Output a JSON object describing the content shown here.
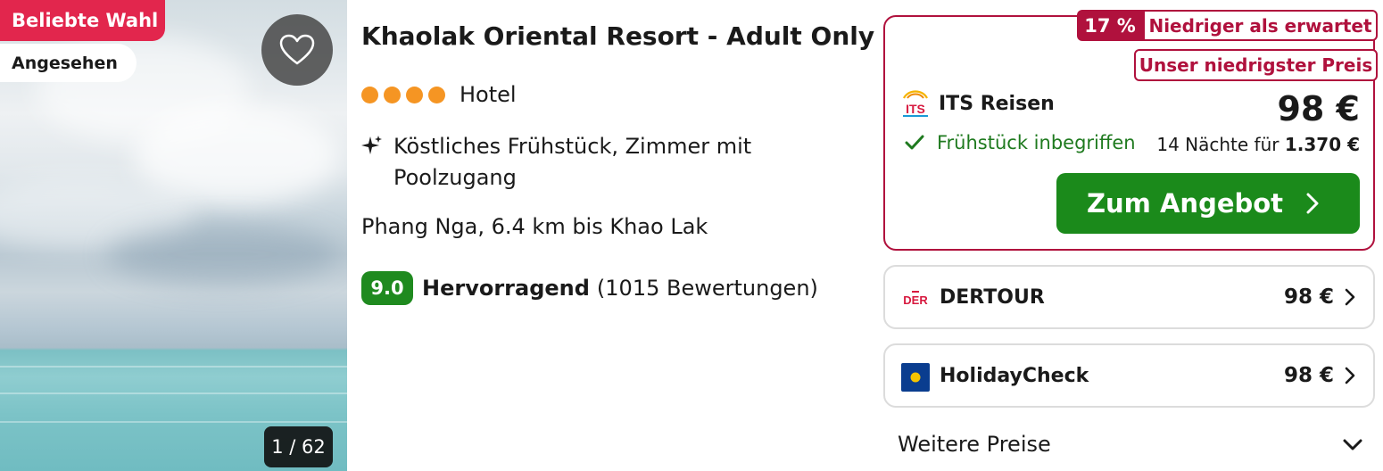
{
  "image": {
    "badge_popular": "Beliebte Wahl",
    "badge_seen": "Angesehen",
    "counter": "1 / 62"
  },
  "hotel": {
    "name": "Khaolak Oriental Resort - Adult Only",
    "stars": 4,
    "type": "Hotel",
    "feature": "Köstliches Frühstück, Zimmer mit Poolzugang",
    "location": "Phang Nga, 6.4 km bis Khao Lak",
    "rating_score": "9.0",
    "rating_word": "Hervorragend",
    "rating_count": "(1015 Bewertungen)"
  },
  "main_offer": {
    "discount_percent": "17 %",
    "discount_label": "Niedriger als erwartet",
    "lowest_label": "Unser niedrigster Preis",
    "provider_logo": "ITS",
    "provider": "ITS Reisen",
    "price": "98 €",
    "breakfast": "Frühstück inbegriffen",
    "nights_prefix": "14 Nächte für",
    "nights_total": "1.370 €",
    "cta": "Zum Angebot"
  },
  "other_offers": [
    {
      "provider_logo": "DER",
      "provider": "DERTOUR",
      "price": "98 €"
    },
    {
      "provider": "HolidayCheck",
      "price": "98 €"
    }
  ],
  "more_prices": "Weitere Preise",
  "colors": {
    "popular_badge": "#e2264d",
    "offer_accent": "#b0113d",
    "cta": "#1b8a1b",
    "rating": "#1f8a1f",
    "stars": "#f59523",
    "its_logo": "#d7193f",
    "der_logo": "#d7193f",
    "holidaycheck_logo": "#0a3d8f"
  }
}
